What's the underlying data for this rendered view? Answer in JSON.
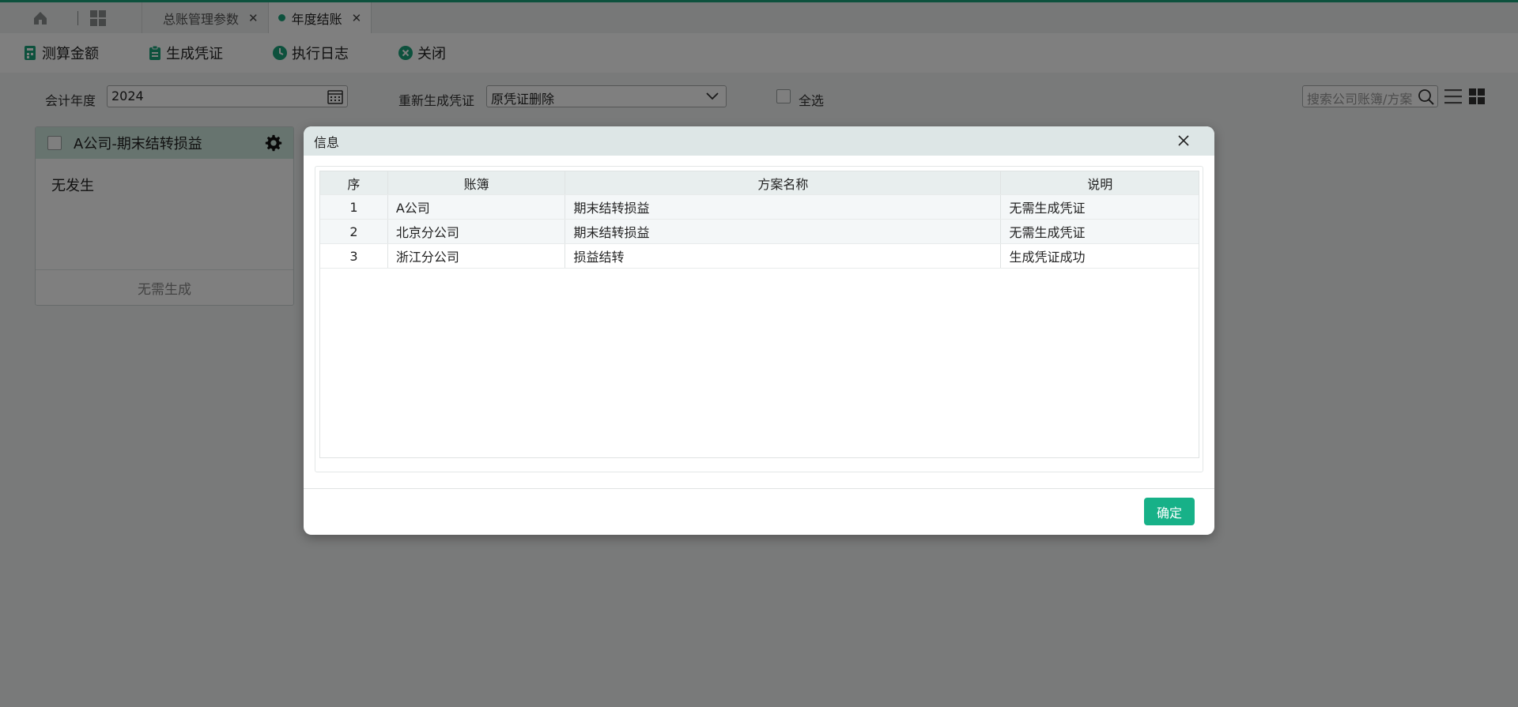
{
  "tabs": [
    {
      "label": "总账管理参数",
      "active": false
    },
    {
      "label": "年度结账",
      "active": true
    }
  ],
  "toolbar": {
    "calc": "测算金额",
    "gen_voucher": "生成凭证",
    "exec_log": "执行日志",
    "close": "关闭"
  },
  "filter": {
    "year_label": "会计年度",
    "year_value": "2024",
    "regen_label": "重新生成凭证",
    "regen_value": "原凭证删除",
    "select_all": "全选",
    "search_placeholder": "搜索公司账簿/方案"
  },
  "card": {
    "title": "A公司-期末结转损益",
    "body": "无发生",
    "footer": "无需生成"
  },
  "dialog": {
    "title": "信息",
    "columns": [
      "序",
      "账簿",
      "方案名称",
      "说明"
    ],
    "rows": [
      [
        "1",
        "A公司",
        "期末结转损益",
        "无需生成凭证"
      ],
      [
        "2",
        "北京分公司",
        "期末结转损益",
        "无需生成凭证"
      ],
      [
        "3",
        "浙江分公司",
        "损益结转",
        "生成凭证成功"
      ]
    ],
    "ok": "确定"
  },
  "colors": {
    "accent": "#1aa27a",
    "button": "#17b188"
  }
}
